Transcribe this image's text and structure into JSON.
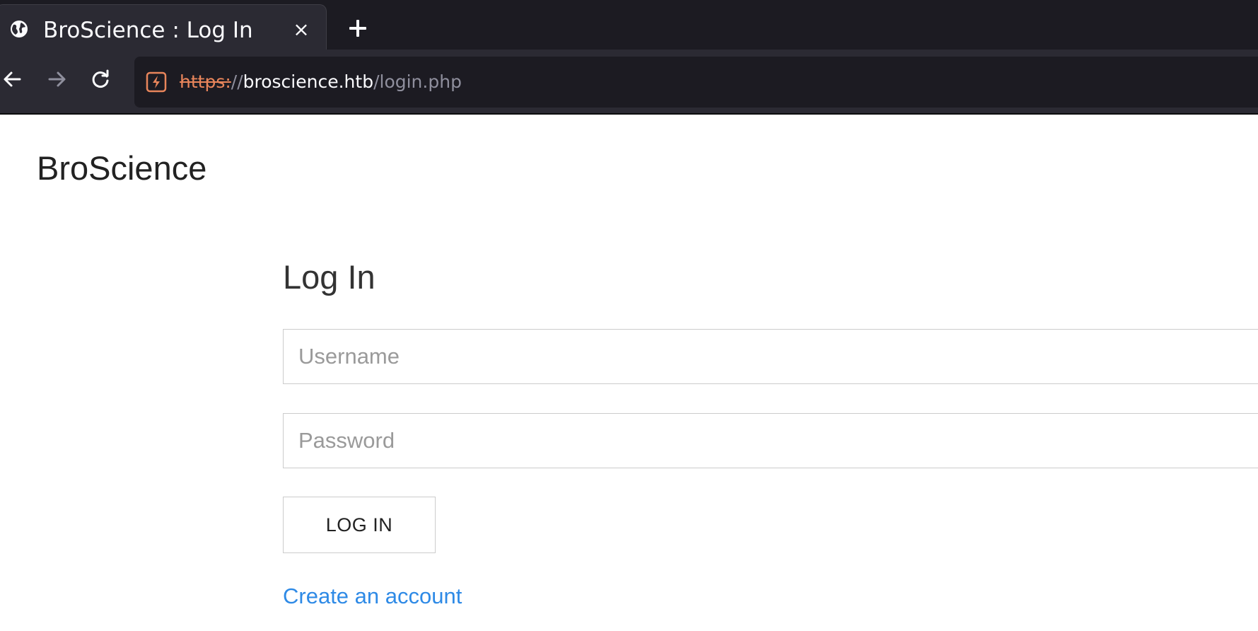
{
  "browser": {
    "tab": {
      "title": "BroScience : Log In",
      "close_symbol": "×",
      "favicon_icon": "globe-icon"
    },
    "new_tab_icon": "plus-icon",
    "nav": {
      "back_icon": "back-arrow-icon",
      "forward_icon": "forward-arrow-icon",
      "reload_icon": "reload-icon"
    },
    "url": {
      "security_icon": "insecure-connection-icon",
      "scheme": "https:",
      "separator": "//",
      "host": "broscience.htb",
      "path": "/login.php"
    },
    "colors": {
      "tab_bar": "#1c1b22",
      "toolbar": "#2b2a33",
      "insecure_accent": "#e8855b"
    }
  },
  "page": {
    "brand": "BroScience",
    "title": "Log In",
    "form": {
      "username_placeholder": "Username",
      "password_placeholder": "Password",
      "submit_label": "LOG IN"
    },
    "create_account_link": "Create an account",
    "colors": {
      "link": "#2e8ae6",
      "input_border": "#cccccc"
    }
  }
}
